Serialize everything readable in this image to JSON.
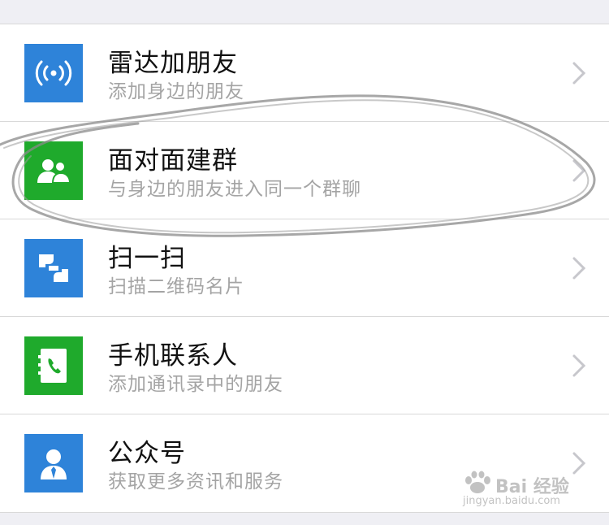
{
  "items": [
    {
      "title": "雷达加朋友",
      "subtitle": "添加身边的朋友",
      "icon": "radar-icon",
      "color": "#2e83d9"
    },
    {
      "title": "面对面建群",
      "subtitle": "与身边的朋友进入同一个群聊",
      "icon": "group-icon",
      "color": "#1faa2c"
    },
    {
      "title": "扫一扫",
      "subtitle": "扫描二维码名片",
      "icon": "scan-icon",
      "color": "#2e83d9"
    },
    {
      "title": "手机联系人",
      "subtitle": "添加通讯录中的朋友",
      "icon": "phone-contacts-icon",
      "color": "#1faa2c"
    },
    {
      "title": "公众号",
      "subtitle": "获取更多资讯和服务",
      "icon": "official-account-icon",
      "color": "#2e83d9"
    }
  ],
  "watermark": {
    "text": "Bai 经验",
    "url": "jingyan.baidu.com"
  },
  "annotation_color": "#8a8a8a"
}
